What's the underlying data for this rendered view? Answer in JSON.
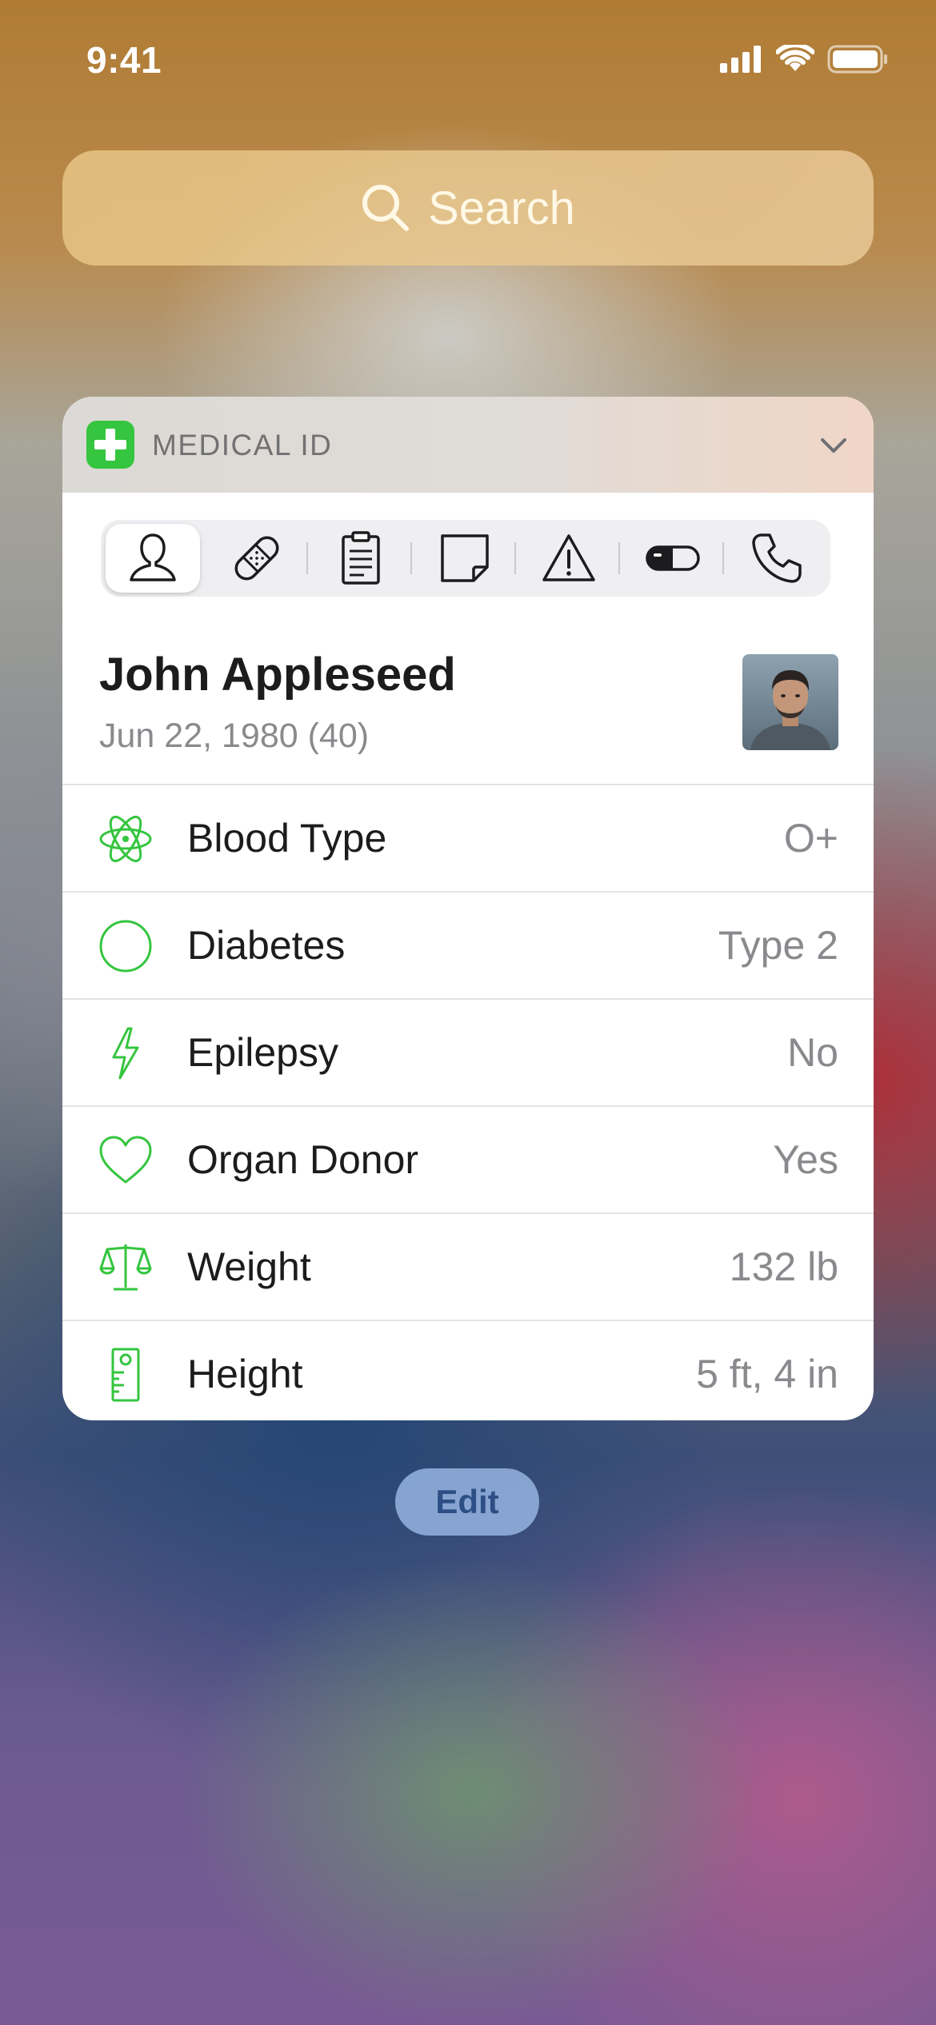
{
  "status_bar": {
    "time": "9:41",
    "icons": [
      "cellular-signal-icon",
      "wifi-icon",
      "battery-icon"
    ]
  },
  "search": {
    "placeholder": "Search",
    "icon": "search-icon"
  },
  "medical_card": {
    "header_title": "MEDICAL ID",
    "accent_color": "#35c53f",
    "tabs": [
      {
        "name": "profile",
        "icon": "person-icon",
        "selected": true
      },
      {
        "name": "conditions",
        "icon": "bandage-icon",
        "selected": false
      },
      {
        "name": "notes",
        "icon": "clipboard-icon",
        "selected": false
      },
      {
        "name": "notes2",
        "icon": "note-icon",
        "selected": false
      },
      {
        "name": "allergies",
        "icon": "warning-icon",
        "selected": false
      },
      {
        "name": "medications",
        "icon": "pill-icon",
        "selected": false
      },
      {
        "name": "emergency-contacts",
        "icon": "phone-icon",
        "selected": false
      }
    ],
    "profile": {
      "name": "John Appleseed",
      "dob": "Jun 22, 1980 (40)"
    },
    "rows": [
      {
        "label": "Blood Type",
        "value": "O+",
        "icon": "atom-icon"
      },
      {
        "label": "Diabetes",
        "value": "Type 2",
        "icon": "circle-icon"
      },
      {
        "label": "Epilepsy",
        "value": "No",
        "icon": "lightning-icon"
      },
      {
        "label": "Organ Donor",
        "value": "Yes",
        "icon": "heart-icon"
      },
      {
        "label": "Weight",
        "value": "132 lb",
        "icon": "scale-icon"
      },
      {
        "label": "Height",
        "value": "5 ft, 4 in",
        "icon": "ruler-icon"
      }
    ]
  },
  "edit_button": {
    "label": "Edit"
  }
}
